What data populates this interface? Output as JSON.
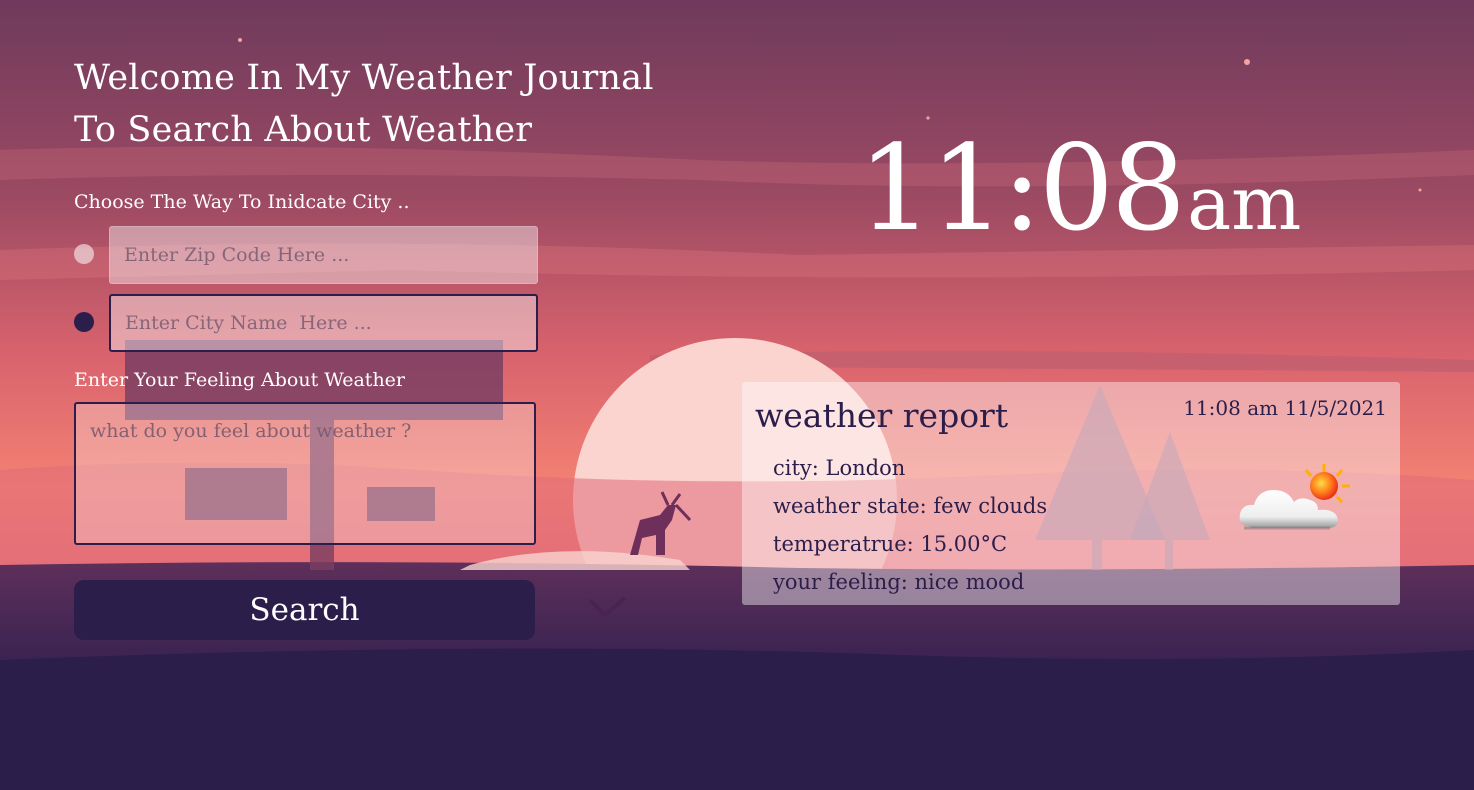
{
  "header": {
    "title_line1": "Welcome In My Weather Journal",
    "title_line2": "To Search About Weather"
  },
  "form": {
    "choose_label": "Choose The Way To Inidcate City ..",
    "zip_placeholder": "Enter Zip Code Here ...",
    "city_placeholder": "Enter City Name  Here ...",
    "zip_value": "",
    "city_value": "",
    "selected_method": "city",
    "feeling_label": "Enter Your Feeling About Weather",
    "feeling_placeholder": "what do you feel about weather ?",
    "search_label": "Search"
  },
  "clock": {
    "time": "11:08",
    "ampm": "am"
  },
  "report": {
    "title": "weather report",
    "datetime": "11:08 am 11/5/2021",
    "city_line": "city: London",
    "state_line": "weather state: few clouds",
    "temp_line": "temperatrue: 15.00°C",
    "feeling_line": "your feeling: nice mood",
    "icon": "few-clouds-day-icon"
  },
  "colors": {
    "sky_top": "#6f3a5c",
    "sky_mid": "#c65a6b",
    "sky_glow": "#f48273",
    "ground": "#2b1e4a",
    "accent": "#2b1e4a",
    "text_light": "#ffffff"
  }
}
